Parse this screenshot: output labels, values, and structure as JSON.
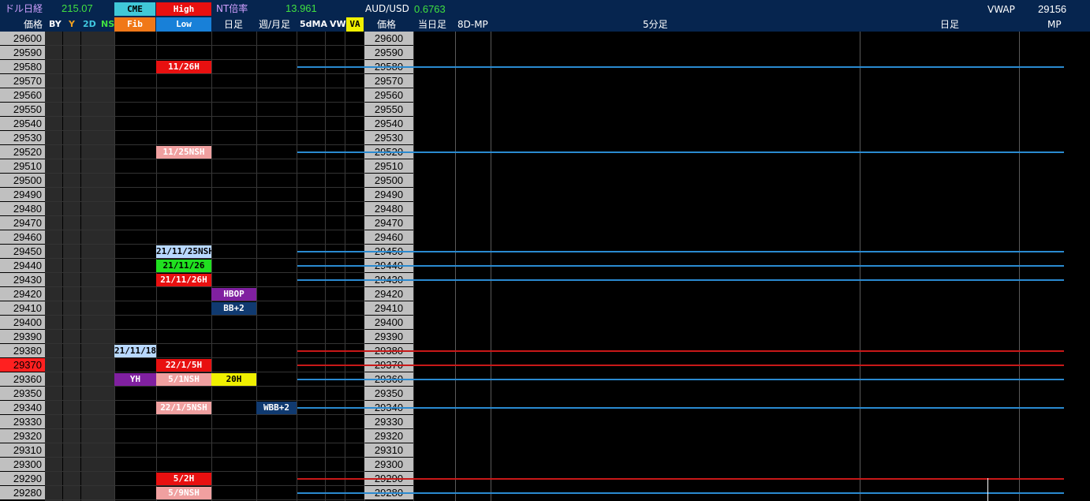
{
  "top_bar": {
    "dollar_nikkei_label": "ドル日経",
    "dollar_nikkei_value": "215.07",
    "cme_label": "CME",
    "high_label": "High",
    "nt_ratio_label": "NT倍率",
    "nt_ratio_value": "13.961",
    "audusd_label": "AUD/USD",
    "audusd_value": "0.6763",
    "vwap_label": "VWAP",
    "vwap_value": "29156"
  },
  "col_headers": {
    "price": "価格",
    "by": "BY",
    "y": "Y",
    "d2": "2D",
    "ns": "NS",
    "fib": "Fib",
    "low": "Low",
    "daily": "日足",
    "weekly_monthly": "週/月足",
    "ma5d": "5dMA",
    "vw": "VW",
    "va": "VA",
    "price2": "価格",
    "today": "当日足",
    "mp8d": "8D-MP",
    "min5": "5分足",
    "daily2": "日足",
    "mp": "MP"
  },
  "prices": [
    "29600",
    "29590",
    "29580",
    "29570",
    "29560",
    "29550",
    "29540",
    "29530",
    "29520",
    "29510",
    "29500",
    "29490",
    "29480",
    "29470",
    "29460",
    "29450",
    "29440",
    "29430",
    "29420",
    "29410",
    "29400",
    "29390",
    "29380",
    "29370",
    "29360",
    "29350",
    "29340",
    "29330",
    "29320",
    "29310",
    "29300",
    "29290",
    "29280"
  ],
  "highlight_price": "29370",
  "labels": [
    {
      "row": 2,
      "col": "hl",
      "text": "11/26H",
      "bg": "#e81010",
      "fg": "#ffffff"
    },
    {
      "row": 8,
      "col": "hl",
      "text": "11/25NSH",
      "bg": "#f0a0a0",
      "fg": "#ffffff"
    },
    {
      "row": 15,
      "col": "hl",
      "text": "21/11/25NSH",
      "bg": "#b8d8ff",
      "fg": "#000000"
    },
    {
      "row": 16,
      "col": "hl",
      "text": "21/11/26",
      "bg": "#20e020",
      "fg": "#000000"
    },
    {
      "row": 17,
      "col": "hl",
      "text": "21/11/26H",
      "bg": "#e81010",
      "fg": "#ffffff"
    },
    {
      "row": 18,
      "col": "day",
      "text": "HBOP",
      "bg": "#8020a0",
      "fg": "#ffffff"
    },
    {
      "row": 19,
      "col": "day",
      "text": "BB+2",
      "bg": "#103a70",
      "fg": "#ffffff"
    },
    {
      "row": 22,
      "col": "fib",
      "text": "21/11/18",
      "bg": "#b8d8ff",
      "fg": "#000000"
    },
    {
      "row": 23,
      "col": "hl",
      "text": "22/1/5H",
      "bg": "#e81010",
      "fg": "#ffffff"
    },
    {
      "row": 24,
      "col": "fib",
      "text": "YH",
      "bg": "#8020a0",
      "fg": "#ffffff"
    },
    {
      "row": 24,
      "col": "hl",
      "text": "5/1NSH",
      "bg": "#f0a0a0",
      "fg": "#ffffff"
    },
    {
      "row": 24,
      "col": "day",
      "text": "20H",
      "bg": "#f0f000",
      "fg": "#000000"
    },
    {
      "row": 26,
      "col": "hl",
      "text": "22/1/5NSH",
      "bg": "#f0a0a0",
      "fg": "#ffffff"
    },
    {
      "row": 26,
      "col": "wk",
      "text": "WBB+2",
      "bg": "#103a70",
      "fg": "#ffffff"
    },
    {
      "row": 31,
      "col": "hl",
      "text": "5/2H",
      "bg": "#e81010",
      "fg": "#ffffff"
    },
    {
      "row": 32,
      "col": "hl",
      "text": "5/9NSH",
      "bg": "#f0a0a0",
      "fg": "#ffffff"
    }
  ],
  "level_lines": [
    {
      "row": 2,
      "color": "#2a8ad0"
    },
    {
      "row": 8,
      "color": "#2a8ad0"
    },
    {
      "row": 15,
      "color": "#2a8ad0"
    },
    {
      "row": 16,
      "color": "#2a8ad0"
    },
    {
      "row": 17,
      "color": "#2a8ad0"
    },
    {
      "row": 22,
      "color": "#c81818"
    },
    {
      "row": 23,
      "color": "#c81818"
    },
    {
      "row": 24,
      "color": "#2a8ad0"
    },
    {
      "row": 26,
      "color": "#2a8ad0"
    },
    {
      "row": 31,
      "color": "#c81818"
    },
    {
      "row": 32,
      "color": "#2a8ad0"
    }
  ],
  "colors": {
    "header_bg": "#06254f",
    "price_bg": "#c0c0c0",
    "highlight_bg": "#ff2020",
    "cyan": "#40d0e0",
    "green": "#40e040",
    "yellow": "#f0f000"
  }
}
